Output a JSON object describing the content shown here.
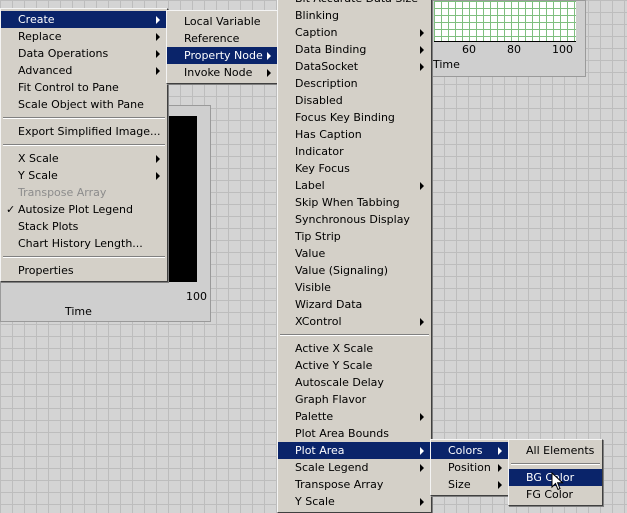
{
  "background": {
    "graph1": {
      "tick": "100",
      "axis_title": "Time"
    },
    "graph2": {
      "ticks": [
        "60",
        "80",
        "100"
      ],
      "axis_title": "Time"
    }
  },
  "main_menu": {
    "items": [
      {
        "label": "Create",
        "submenu": true,
        "highlighted": true
      },
      {
        "label": "Replace",
        "submenu": true
      },
      {
        "label": "Data Operations",
        "submenu": true
      },
      {
        "label": "Advanced",
        "submenu": true
      },
      {
        "label": "Fit Control to Pane"
      },
      {
        "label": "Scale Object with Pane"
      },
      {
        "separator": true
      },
      {
        "label": "Export Simplified Image..."
      },
      {
        "separator": true
      },
      {
        "label": "X Scale",
        "submenu": true
      },
      {
        "label": "Y Scale",
        "submenu": true
      },
      {
        "label": "Transpose Array",
        "disabled": true
      },
      {
        "label": "Autosize Plot Legend",
        "checked": true
      },
      {
        "label": "Stack Plots"
      },
      {
        "label": "Chart History Length..."
      },
      {
        "separator": true
      },
      {
        "label": "Properties"
      }
    ]
  },
  "create_menu": {
    "items": [
      {
        "label": "Local Variable"
      },
      {
        "label": "Reference"
      },
      {
        "label": "Property Node",
        "submenu": true,
        "highlighted": true
      },
      {
        "label": "Invoke Node",
        "submenu": true
      }
    ]
  },
  "property_menu": {
    "items": [
      {
        "label": "Bit Accurate Data Size"
      },
      {
        "label": "Blinking"
      },
      {
        "label": "Caption",
        "submenu": true
      },
      {
        "label": "Data Binding",
        "submenu": true
      },
      {
        "label": "DataSocket",
        "submenu": true
      },
      {
        "label": "Description"
      },
      {
        "label": "Disabled"
      },
      {
        "label": "Focus Key Binding"
      },
      {
        "label": "Has Caption"
      },
      {
        "label": "Indicator"
      },
      {
        "label": "Key Focus"
      },
      {
        "label": "Label",
        "submenu": true
      },
      {
        "label": "Skip When Tabbing"
      },
      {
        "label": "Synchronous Display"
      },
      {
        "label": "Tip Strip"
      },
      {
        "label": "Value"
      },
      {
        "label": "Value (Signaling)"
      },
      {
        "label": "Visible"
      },
      {
        "label": "Wizard Data"
      },
      {
        "label": "XControl",
        "submenu": true
      },
      {
        "separator": true
      },
      {
        "label": "Active X Scale"
      },
      {
        "label": "Active Y Scale"
      },
      {
        "label": "Autoscale Delay"
      },
      {
        "label": "Graph Flavor"
      },
      {
        "label": "Palette",
        "submenu": true
      },
      {
        "label": "Plot Area Bounds"
      },
      {
        "label": "Plot Area",
        "submenu": true,
        "highlighted": true
      },
      {
        "label": "Scale Legend",
        "submenu": true
      },
      {
        "label": "Transpose Array"
      },
      {
        "label": "Y Scale",
        "submenu": true
      }
    ]
  },
  "plot_area_menu": {
    "items": [
      {
        "label": "Colors",
        "submenu": true,
        "highlighted": true
      },
      {
        "label": "Position",
        "submenu": true
      },
      {
        "label": "Size",
        "submenu": true
      }
    ]
  },
  "colors_menu": {
    "items": [
      {
        "label": "All Elements"
      },
      {
        "separator": true
      },
      {
        "label": "BG Color",
        "highlighted": true
      },
      {
        "label": "FG Color"
      }
    ]
  },
  "colors": {
    "menu_bg": "#d4d0c8",
    "highlight": "#0a246a",
    "canvas": "#d4d4d4"
  },
  "icons": {
    "cursor": "arrow-cursor-icon",
    "submenu": "submenu-arrow-icon",
    "check": "checkmark-icon"
  }
}
